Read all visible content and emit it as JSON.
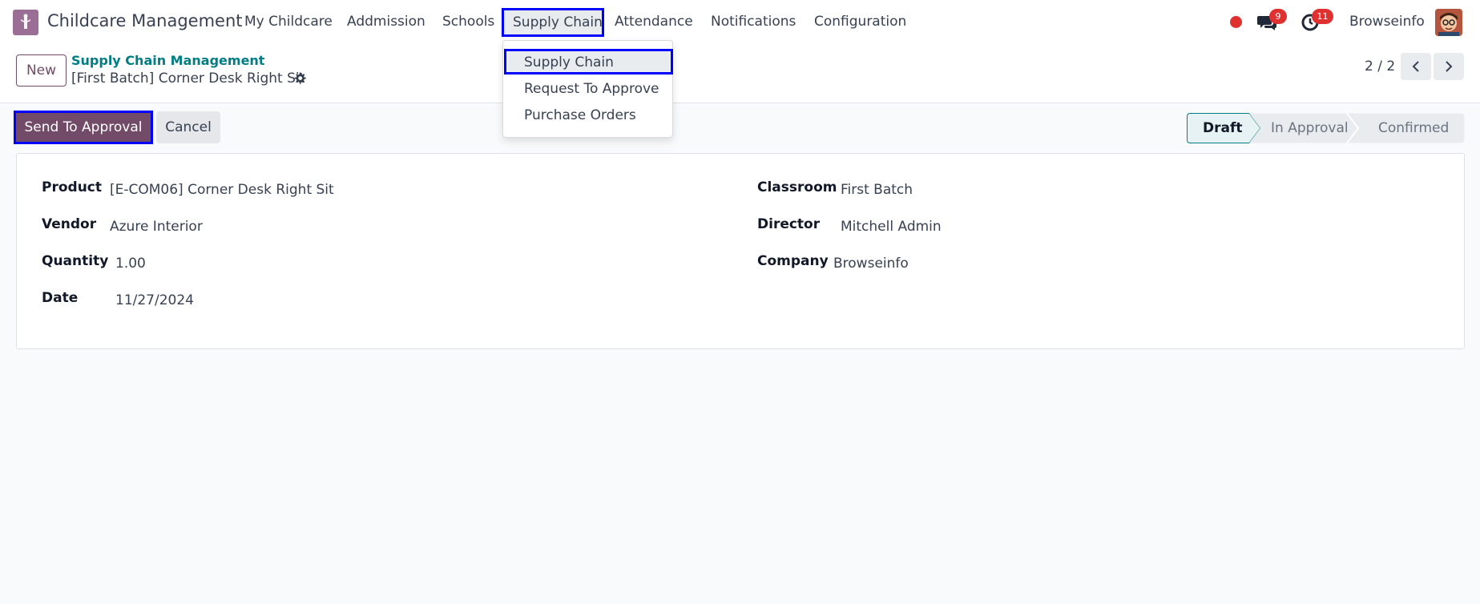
{
  "app": {
    "title": "Childcare Management"
  },
  "nav": {
    "my_childcare": "My Childcare",
    "admission": "Addmission",
    "schools": "Schools",
    "supply_chain": "Supply Chain",
    "attendance": "Attendance",
    "notifications": "Notifications",
    "configuration": "Configuration"
  },
  "dropdown": {
    "items": [
      "Supply Chain",
      "Request To Approve",
      "Purchase Orders"
    ]
  },
  "systray": {
    "messages_count": "9",
    "activities_count": "11",
    "user_name": "Browseinfo"
  },
  "control": {
    "new_label": "New",
    "breadcrumb_parent": "Supply Chain Management",
    "record_name": "[First Batch] Corner Desk Right Sit",
    "pager": "2 / 2"
  },
  "actions": {
    "send_label": "Send To Approval",
    "cancel_label": "Cancel"
  },
  "statusbar": {
    "stages": [
      "Draft",
      "In Approval",
      "Confirmed"
    ],
    "active": "Draft"
  },
  "form": {
    "product_label": "Product",
    "product_value": "[E-COM06] Corner Desk Right Sit",
    "vendor_label": "Vendor",
    "vendor_value": "Azure Interior",
    "quantity_label": "Quantity",
    "quantity_value": "1.00",
    "date_label": "Date",
    "date_value": "11/27/2024",
    "classroom_label": "Classroom",
    "classroom_value": "First Batch",
    "director_label": "Director",
    "director_value": "Mitchell Admin",
    "company_label": "Company",
    "company_value": "Browseinfo"
  },
  "colors": {
    "brand": "#714b67",
    "link": "#017e84",
    "highlight": "#0000ff",
    "badge": "#e03131"
  }
}
